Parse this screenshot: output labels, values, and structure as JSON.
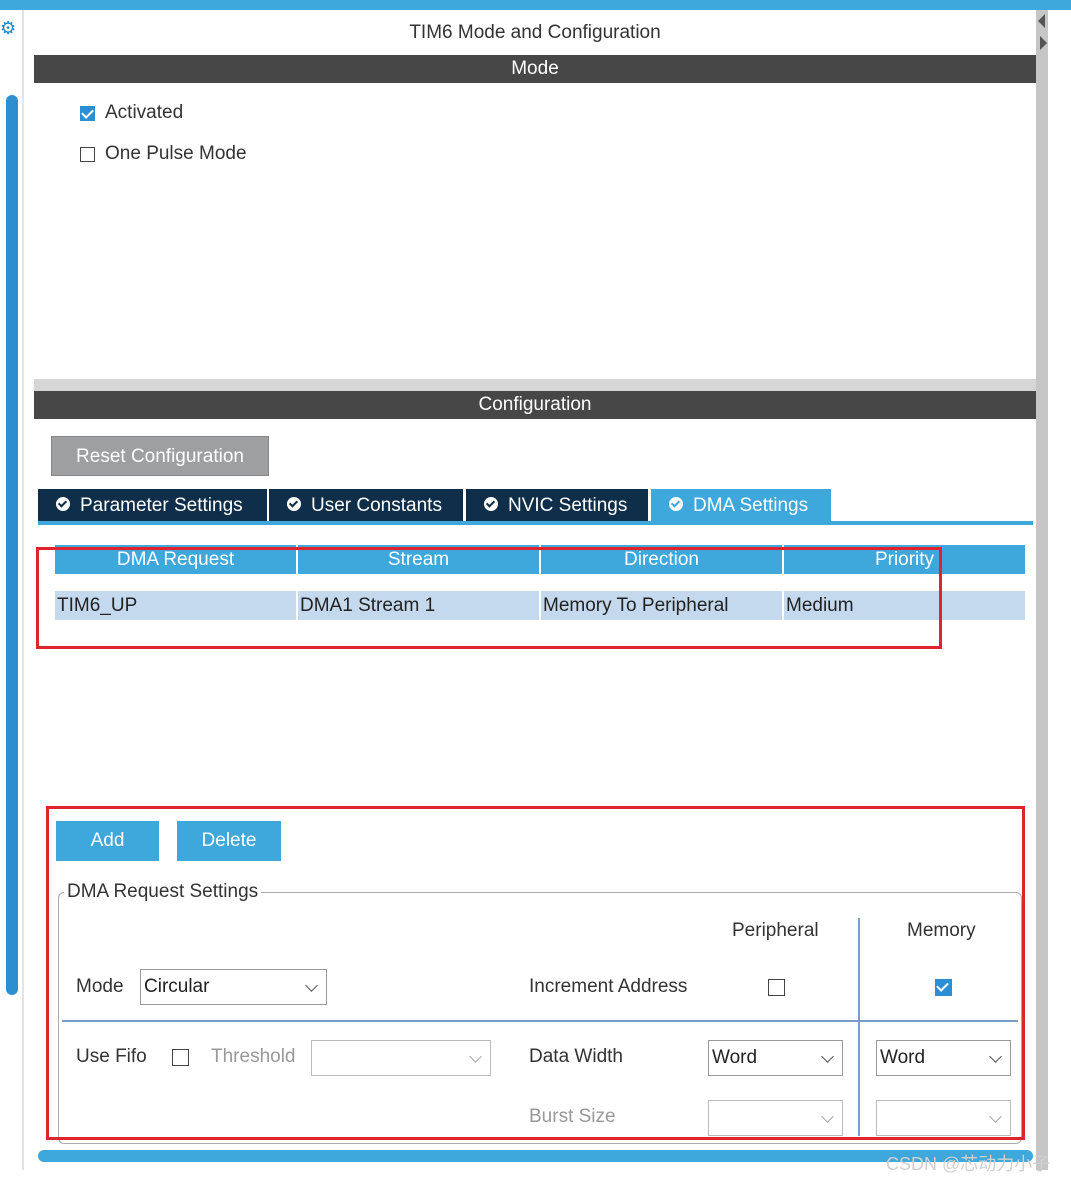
{
  "window": {
    "title": "TIM6 Mode and Configuration"
  },
  "mode": {
    "header": "Mode",
    "activated": {
      "label": "Activated",
      "checked": true
    },
    "one_pulse": {
      "label": "One Pulse Mode",
      "checked": false
    }
  },
  "configuration": {
    "header": "Configuration",
    "reset_button": "Reset Configuration",
    "tabs": [
      {
        "label": "Parameter Settings",
        "active": false
      },
      {
        "label": "User Constants",
        "active": false
      },
      {
        "label": "NVIC Settings",
        "active": false
      },
      {
        "label": "DMA Settings",
        "active": true
      }
    ]
  },
  "dma_table": {
    "columns": [
      "DMA Request",
      "Stream",
      "Direction",
      "Priority"
    ],
    "rows": [
      [
        "TIM6_UP",
        "DMA1 Stream 1",
        "Memory To Peripheral",
        "Medium"
      ]
    ]
  },
  "actions": {
    "add": "Add",
    "delete": "Delete"
  },
  "dma_request_settings": {
    "legend": "DMA Request Settings",
    "peripheral_header": "Peripheral",
    "memory_header": "Memory",
    "mode_label": "Mode",
    "mode_value": "Circular",
    "increment_address_label": "Increment Address",
    "increment_peripheral_checked": false,
    "increment_memory_checked": true,
    "use_fifo_label": "Use Fifo",
    "use_fifo_checked": false,
    "threshold_label": "Threshold",
    "threshold_value": "",
    "data_width_label": "Data Width",
    "data_width_peripheral": "Word",
    "data_width_memory": "Word",
    "burst_size_label": "Burst Size",
    "burst_size_peripheral": "",
    "burst_size_memory": ""
  },
  "watermark": "CSDN @芯动力小子",
  "colors": {
    "accent": "#3ea7dc",
    "header_dark": "#474747",
    "tab_dark": "#0f2e4a",
    "highlight_red": "#e0242f",
    "row_selected": "#c5d9ee"
  },
  "icons": [
    "gear-icon",
    "check-circle-icon",
    "chevron-down-icon"
  ]
}
